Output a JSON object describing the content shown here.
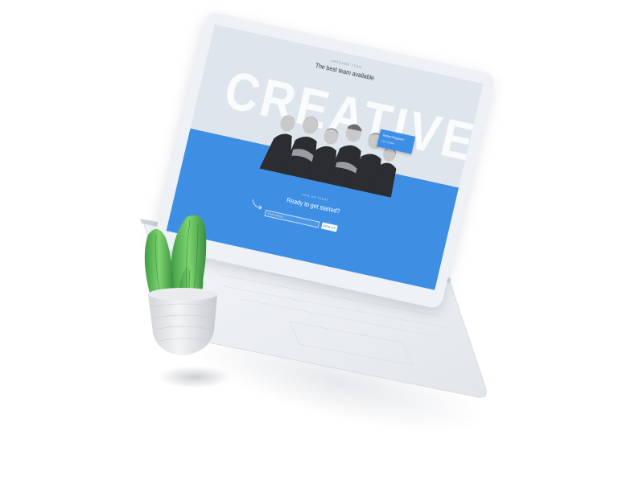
{
  "screen": {
    "hero": {
      "eyebrow": "awesome team",
      "title": "The best team available",
      "background_word": "CREATIVE"
    },
    "callout": {
      "name": "Robert Ferguson",
      "role": "CEO, founder"
    },
    "cta": {
      "eyebrow": "join us today",
      "title": "Ready to get started?",
      "email_placeholder": "Email address",
      "signup_label": "SIGN UP"
    }
  },
  "colors": {
    "accent": "#3e8fe3",
    "hero_bg": "#dfe5ec",
    "pot": "#e4e6e8",
    "cactus": "#5fbf5a"
  }
}
